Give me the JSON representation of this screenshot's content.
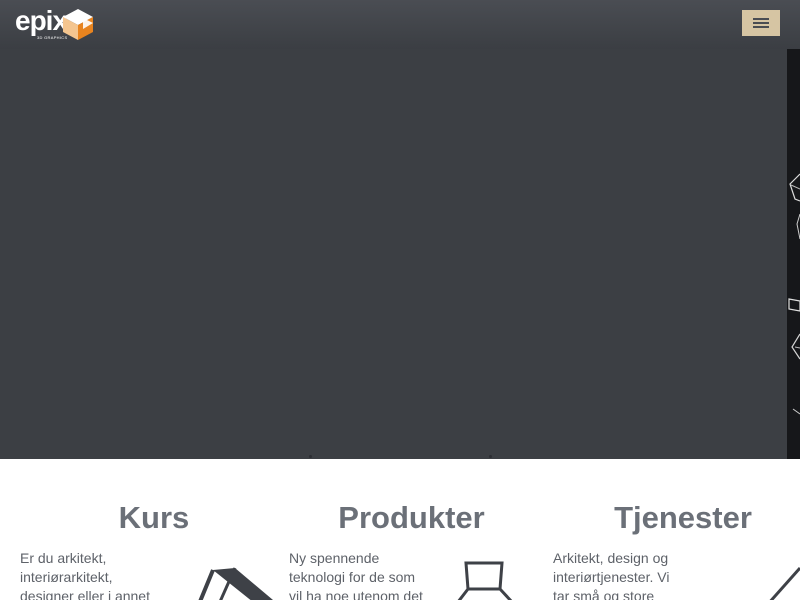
{
  "header": {
    "logo": {
      "word": "epix",
      "subtitle": "3D GRAPHICS",
      "colors": {
        "orange": "#e8841f",
        "light": "#f4c58f",
        "white": "#ffffff"
      }
    },
    "menu_icon": "hamburger-menu-icon",
    "menu_button_color": "#d6c5a3"
  },
  "hero": {
    "background": "#3c3f44"
  },
  "cards": [
    {
      "title": "Kurs",
      "text": "Er du arkitekt, interiørarkitekt, designer eller i annet",
      "icon": "lounge-chair-icon"
    },
    {
      "title": "Produkter",
      "text": "Ny spennende teknologi for de som vil ha noe utenom det",
      "icon": "chair-icon"
    },
    {
      "title": "Tjenester",
      "text": "Arkitekt, design og interiørtjenester. Vi tar små og store",
      "icon": "lamp-icon"
    }
  ]
}
